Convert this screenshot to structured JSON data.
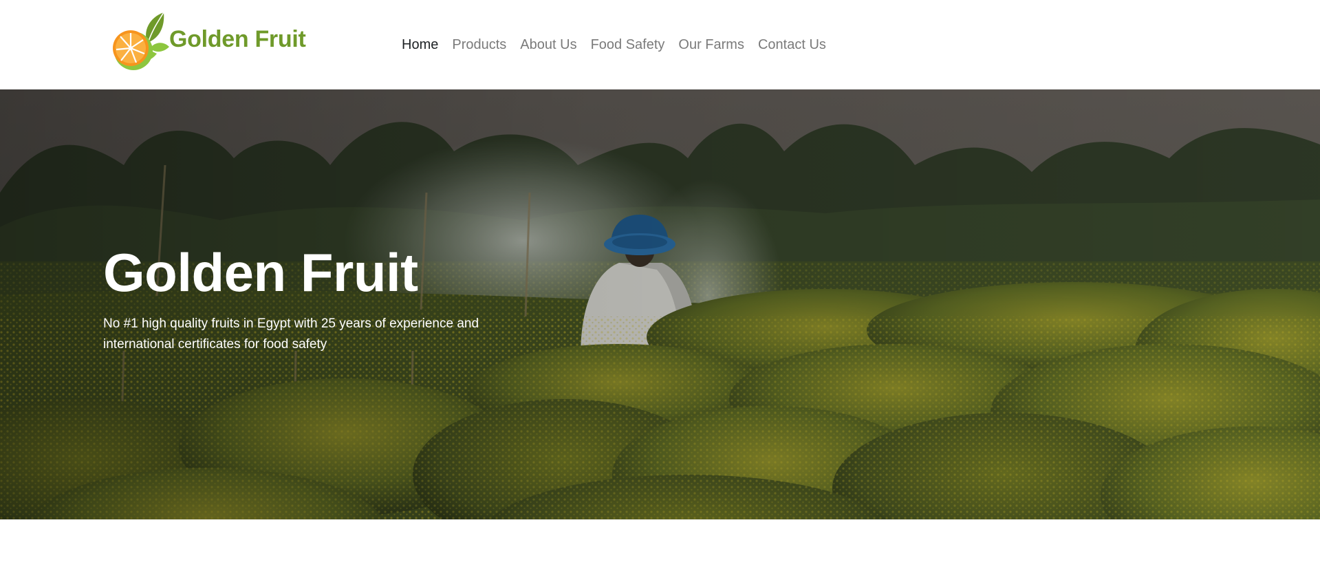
{
  "brand": {
    "name": "Golden Fruit",
    "logo_icon": "orange-slice-with-leaves-icon",
    "colors": {
      "text": "#6f9a2a",
      "orange": "#f7941d",
      "green": "#8dc63f"
    }
  },
  "nav": {
    "items": [
      {
        "label": "Home",
        "active": true
      },
      {
        "label": "Products",
        "active": false
      },
      {
        "label": "About Us",
        "active": false
      },
      {
        "label": "Food Safety",
        "active": false
      },
      {
        "label": "Our Farms",
        "active": false
      },
      {
        "label": "Contact Us",
        "active": false
      }
    ]
  },
  "hero": {
    "title": "Golden Fruit",
    "text": "No #1 high quality fruits in Egypt with 25 years of experience and international certificates for food safety",
    "image": "farmer-watering-flower-field-photo"
  }
}
